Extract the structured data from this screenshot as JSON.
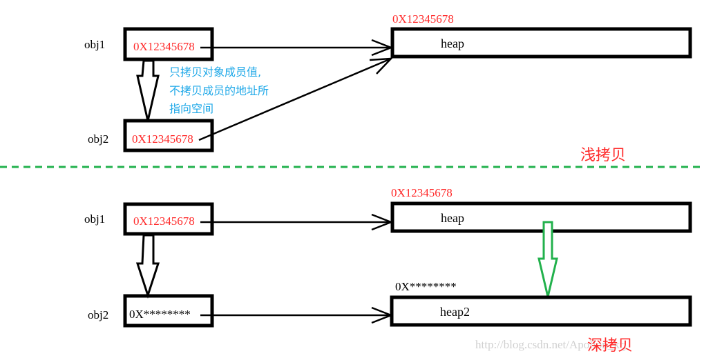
{
  "colors": {
    "address": "#ff2a2a",
    "note": "#1ea8e8",
    "divider": "#22b14c",
    "title": "#ff2a2a",
    "watermark": "#d0d0d0",
    "deep_arrow": "#22b14c"
  },
  "shallow": {
    "obj1_label": "obj1",
    "obj1_value": "0X12345678",
    "obj2_label": "obj2",
    "obj2_value": "0X12345678",
    "heap_address": "0X12345678",
    "heap_label": "heap",
    "note_lines": [
      "只拷贝对象成员值,",
      "不拷贝成员的地址所",
      "指向空间"
    ],
    "title": "浅拷贝"
  },
  "deep": {
    "obj1_label": "obj1",
    "obj1_value": "0X12345678",
    "obj2_label": "obj2",
    "obj2_value": "0X********",
    "heap_address": "0X12345678",
    "heap_label": "heap",
    "heap2_address": "0X********",
    "heap2_label": "heap2",
    "title": "深拷贝"
  },
  "watermark": "http://blog.csdn.net/Apollon_krj"
}
